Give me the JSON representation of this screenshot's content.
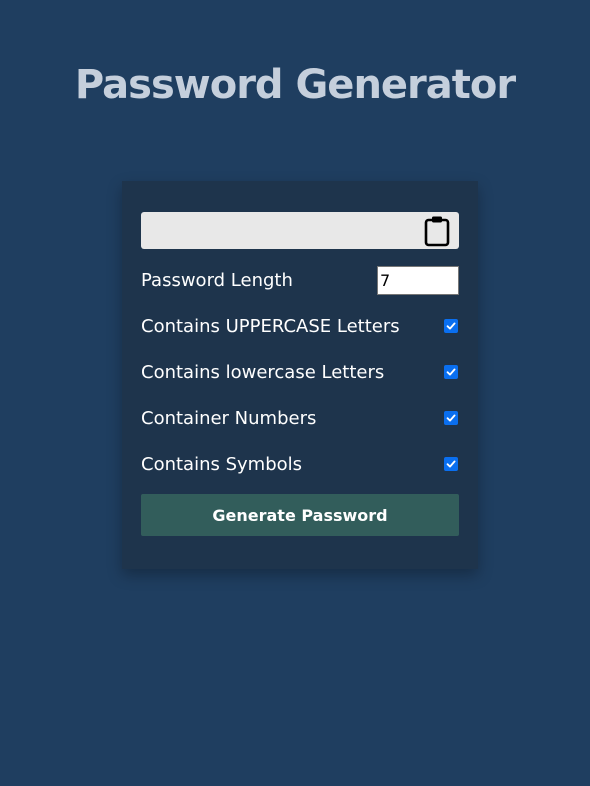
{
  "title": "Password Generator",
  "result": {
    "value": "",
    "icon": "clipboard-icon"
  },
  "settings": {
    "length": {
      "label": "Password Length",
      "value": "7"
    },
    "uppercase": {
      "label": "Contains UPPERCASE Letters",
      "checked": true
    },
    "lowercase": {
      "label": "Contains lowercase Letters",
      "checked": true
    },
    "numbers": {
      "label": "Container Numbers",
      "checked": true
    },
    "symbols": {
      "label": "Contains Symbols",
      "checked": true
    }
  },
  "generate_button": {
    "label": "Generate Password"
  },
  "colors": {
    "background": "#1f3e60",
    "card": "#1e344c",
    "title": "#c5cfdc",
    "button": "#325d5b",
    "checkbox": "#0a6ff0"
  }
}
